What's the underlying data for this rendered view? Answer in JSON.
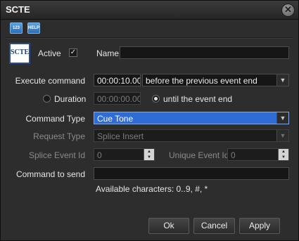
{
  "window": {
    "title": "SCTE",
    "close_glyph": "✕"
  },
  "toolbar": {
    "icon1_text": "123",
    "icon2_text": "HELP"
  },
  "logo_text": "SCTE",
  "active": {
    "label": "Active",
    "checked": true
  },
  "name": {
    "label": "Name",
    "value": ""
  },
  "execute": {
    "label": "Execute command",
    "time": "00:00:10.00",
    "relation": "before the previous event end"
  },
  "duration": {
    "label": "Duration",
    "value": "00:00:00.00",
    "selected": false
  },
  "until_end": {
    "label": "until the event end",
    "selected": true
  },
  "command_type": {
    "label": "Command Type",
    "value": "Cue Tone"
  },
  "request_type": {
    "label": "Request Type",
    "value": "Splice Insert"
  },
  "splice_event_id": {
    "label": "Splice Event Id",
    "value": "0"
  },
  "unique_event_id": {
    "label": "Unique Event Id",
    "value": "0"
  },
  "command_to_send": {
    "label": "Command to send",
    "value": ""
  },
  "available_chars": "Available characters: 0..9, #, *",
  "buttons": {
    "ok": "Ok",
    "cancel": "Cancel",
    "apply": "Apply"
  },
  "colors": {
    "selection": "#2f6cd6",
    "background": "#2d2d2d"
  }
}
